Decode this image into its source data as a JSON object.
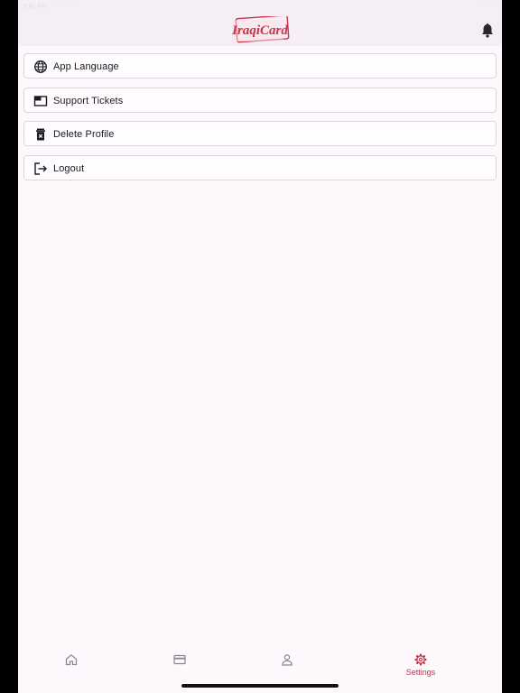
{
  "status_bar": {
    "left_text": "9:41 AM  ·  ⋯ ⋯ ⋯",
    "right_text": "⋯ ⋯"
  },
  "header": {
    "logo_text": "IraqiCard",
    "notification_icon": "bell-icon"
  },
  "menu": {
    "items": [
      {
        "label": "App Language",
        "icon": "globe-icon"
      },
      {
        "label": "Support Tickets",
        "icon": "ticket-window-icon"
      },
      {
        "label": "Delete Profile",
        "icon": "trash-icon"
      },
      {
        "label": "Logout",
        "icon": "logout-icon"
      }
    ]
  },
  "bottom_nav": {
    "items": [
      {
        "icon": "home-icon",
        "label": ""
      },
      {
        "icon": "card-icon",
        "label": ""
      },
      {
        "icon": "profile-icon",
        "label": ""
      },
      {
        "icon": "gear-icon",
        "label": "Settings",
        "active": true
      }
    ]
  },
  "colors": {
    "accent": "#c8334a",
    "background": "#fcf8fc",
    "header_background": "#f5eef7",
    "card_border": "#dcd5de",
    "text": "#1c1a1e",
    "icon_inactive": "#8a858c"
  }
}
